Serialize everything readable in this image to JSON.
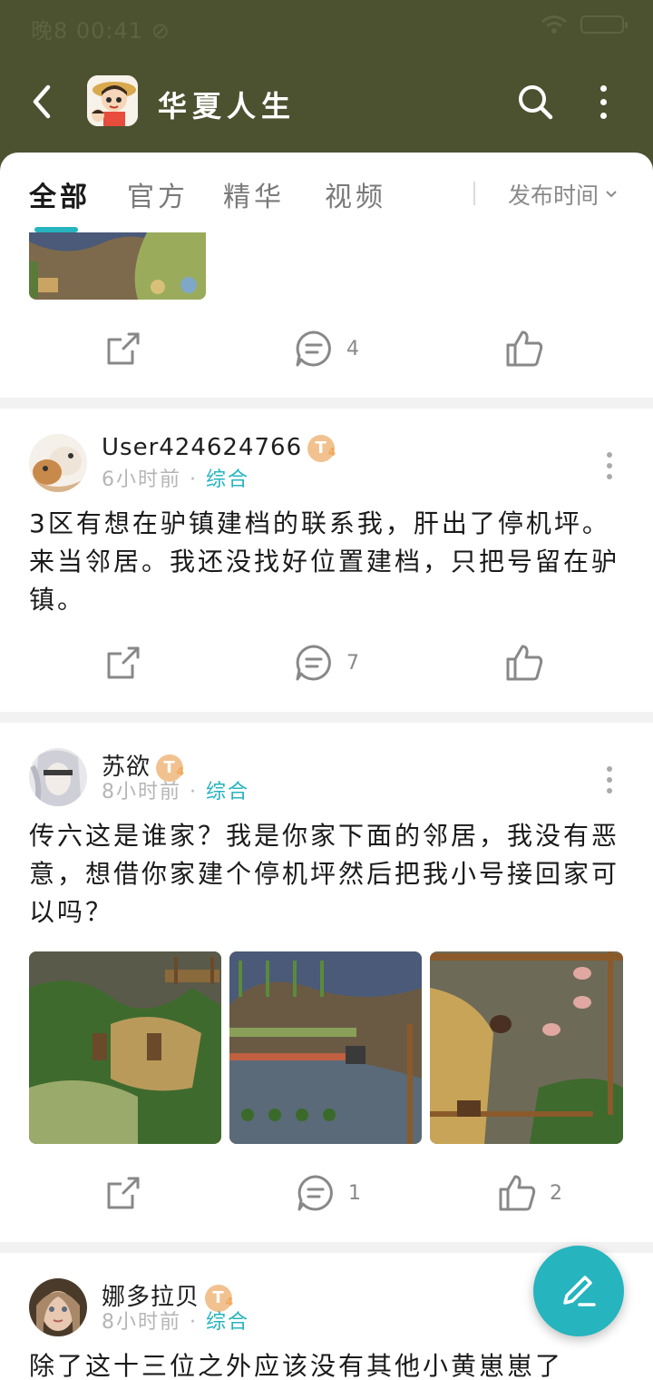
{
  "status_bar": {
    "time": "晚8 00:41 ⊘"
  },
  "header": {
    "title": "华夏人生"
  },
  "tabs": [
    {
      "label": "全部",
      "active": true
    },
    {
      "label": "官方",
      "active": false
    },
    {
      "label": "精华",
      "active": false
    },
    {
      "label": "视频",
      "active": false
    }
  ],
  "sort": {
    "label": "发布时间"
  },
  "posts": [
    {
      "comments": "4",
      "likes": ""
    },
    {
      "user": "User424624766",
      "level": "T",
      "level_sub": "4",
      "time": "6小时前",
      "category": "综合",
      "text": "3区有想在驴镇建档的联系我，肝出了停机坪。来当邻居。我还没找好位置建档，只把号留在驴镇。",
      "comments": "7",
      "likes": ""
    },
    {
      "user": "苏欲",
      "level": "T",
      "level_sub": "4",
      "time": "8小时前",
      "category": "综合",
      "text": "传六这是谁家？我是你家下面的邻居，我没有恶意，想借你家建个停机坪然后把我小号接回家可以吗？",
      "comments": "1",
      "likes": "2"
    },
    {
      "user": "娜多拉贝",
      "level": "T",
      "level_sub": "4",
      "time": "8小时前",
      "category": "综合",
      "text": "除了这十三位之外应该没有其他小黄崽崽了"
    }
  ],
  "colors": {
    "header_bg": "#4c5230",
    "accent": "#26b4be",
    "badge": "#f1c28f"
  },
  "icons": [
    "back-icon",
    "search-icon",
    "more-icon",
    "share-icon",
    "comment-icon",
    "like-icon",
    "edit-icon",
    "chevron-down-icon"
  ]
}
